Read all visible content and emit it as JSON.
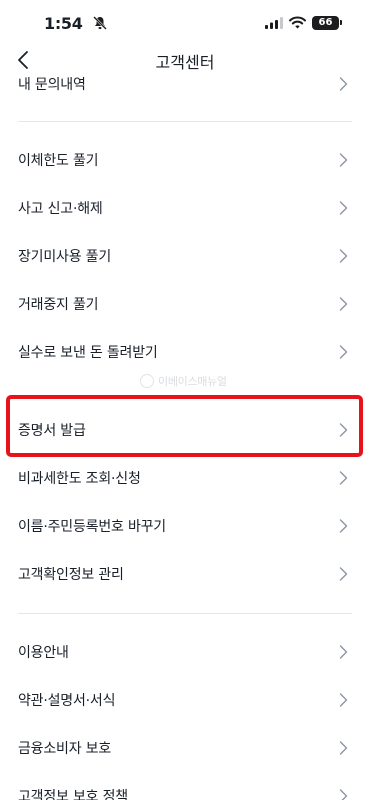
{
  "status_bar": {
    "time": "1:54",
    "battery": "66"
  },
  "header": {
    "title": "고객센터"
  },
  "menu": {
    "top_partial": "내 문의내역",
    "group1": [
      {
        "label": "이체한도 풀기"
      },
      {
        "label": "사고 신고·해제"
      },
      {
        "label": "장기미사용 풀기"
      },
      {
        "label": "거래중지 풀기"
      },
      {
        "label": "실수로 보낸 돈 돌려받기"
      },
      {
        "label": "증명서 발급"
      },
      {
        "label": "비과세한도 조회·신청"
      },
      {
        "label": "이름·주민등록번호 바꾸기"
      },
      {
        "label": "고객확인정보 관리"
      }
    ],
    "group2": [
      {
        "label": "이용안내"
      },
      {
        "label": "약관·설명서·서식"
      },
      {
        "label": "금융소비자 보호"
      },
      {
        "label": "고객정보 보호 정책"
      }
    ]
  },
  "watermark": {
    "text": "이베이스매뉴얼"
  },
  "highlight": {
    "color": "#e8121b",
    "target": "증명서 발급"
  }
}
